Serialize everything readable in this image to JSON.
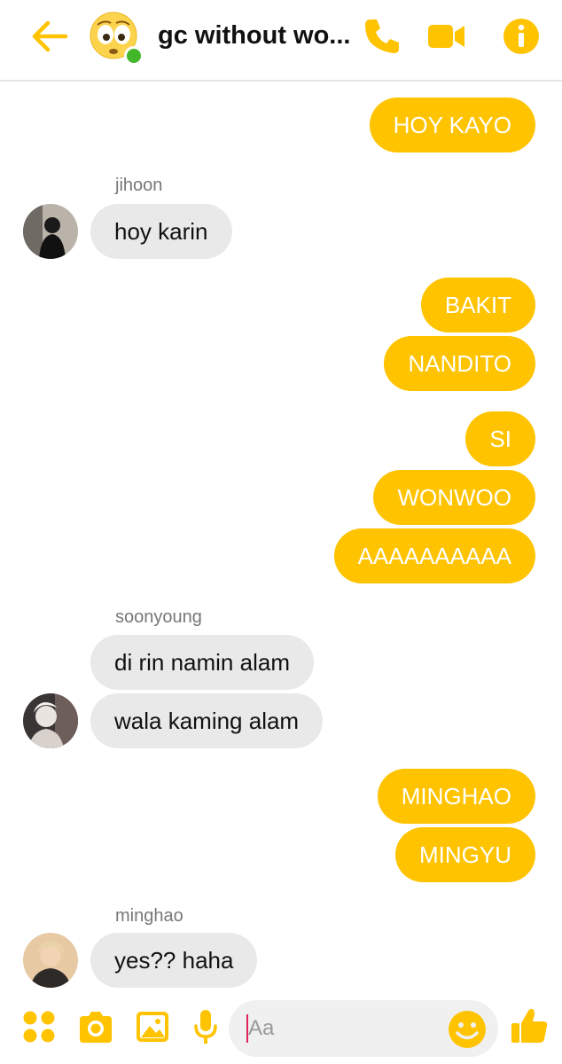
{
  "header": {
    "title": "gc without wo...",
    "accent": "#ffc300"
  },
  "messages": [
    {
      "text": "HOY KAYO",
      "direction": "out"
    },
    {
      "sender": "jihoon",
      "text": "hoy karin",
      "direction": "in"
    },
    {
      "text": "BAKIT",
      "direction": "out"
    },
    {
      "text": "NANDITO",
      "direction": "out"
    },
    {
      "text": "SI",
      "direction": "out"
    },
    {
      "text": "WONWOO",
      "direction": "out"
    },
    {
      "text": "AAAAAAAAAA",
      "direction": "out"
    },
    {
      "sender": "soonyoung",
      "text": "di rin namin alam",
      "direction": "in"
    },
    {
      "text": "wala kaming alam",
      "direction": "in"
    },
    {
      "text": "MINGHAO",
      "direction": "out"
    },
    {
      "text": "MINGYU",
      "direction": "out"
    },
    {
      "sender": "minghao",
      "text": "yes?? haha",
      "direction": "in"
    }
  ],
  "composer": {
    "placeholder": "Aa"
  },
  "icons": [
    "back-arrow-icon",
    "phone-icon",
    "video-camera-icon",
    "info-icon",
    "more-apps-icon",
    "camera-icon",
    "gallery-icon",
    "microphone-icon",
    "emoji-icon",
    "thumbs-up-icon"
  ]
}
